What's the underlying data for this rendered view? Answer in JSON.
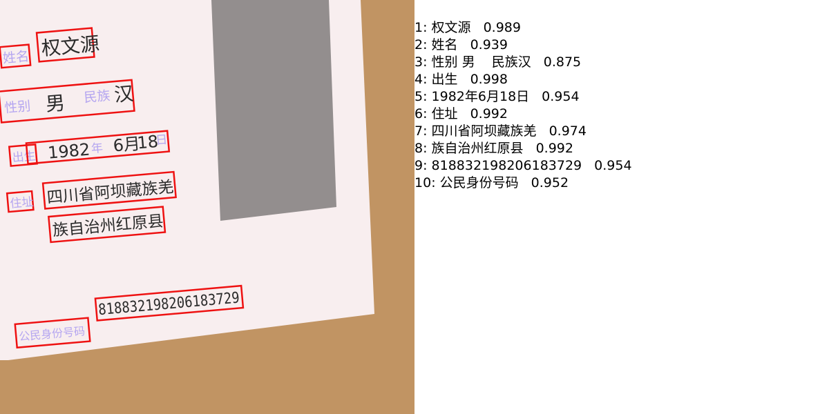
{
  "colors": {
    "background": "#c19463",
    "card": "#f8eeef",
    "photo": "#938e8e",
    "box": "#ee1111",
    "label": "#b5a6f0",
    "text": "#2b2b2b"
  },
  "card": {
    "name_label": "姓名",
    "name_value": "权文源",
    "sex_label": "性别",
    "sex_value": "男",
    "ethnicity_label": "民族",
    "ethnicity_value": "汉",
    "birth_label": "出生",
    "birth_year": "1982",
    "year_char": "年",
    "birth_month": "6月",
    "birth_day": "18",
    "day_char": "日",
    "address_label": "住址",
    "address_line1": "四川省阿坝藏族羌",
    "address_line2": "族自治州红原县",
    "id_label": "公民身份号码",
    "id_value": "818832198206183729"
  },
  "results": [
    {
      "index": "1",
      "text": "权文源",
      "score": "0.989"
    },
    {
      "index": "2",
      "text": "姓名",
      "score": "0.939"
    },
    {
      "index": "3",
      "text": "性别 男    民族汉",
      "score": "0.875"
    },
    {
      "index": "4",
      "text": "出生",
      "score": "0.998"
    },
    {
      "index": "5",
      "text": "1982年6月18日",
      "score": "0.954"
    },
    {
      "index": "6",
      "text": "住址",
      "score": "0.992"
    },
    {
      "index": "7",
      "text": "四川省阿坝藏族羌",
      "score": "0.974"
    },
    {
      "index": "8",
      "text": "族自治州红原县",
      "score": "0.992"
    },
    {
      "index": "9",
      "text": "818832198206183729",
      "score": "0.954"
    },
    {
      "index": "10",
      "text": "公民身份号码",
      "score": "0.952"
    }
  ]
}
